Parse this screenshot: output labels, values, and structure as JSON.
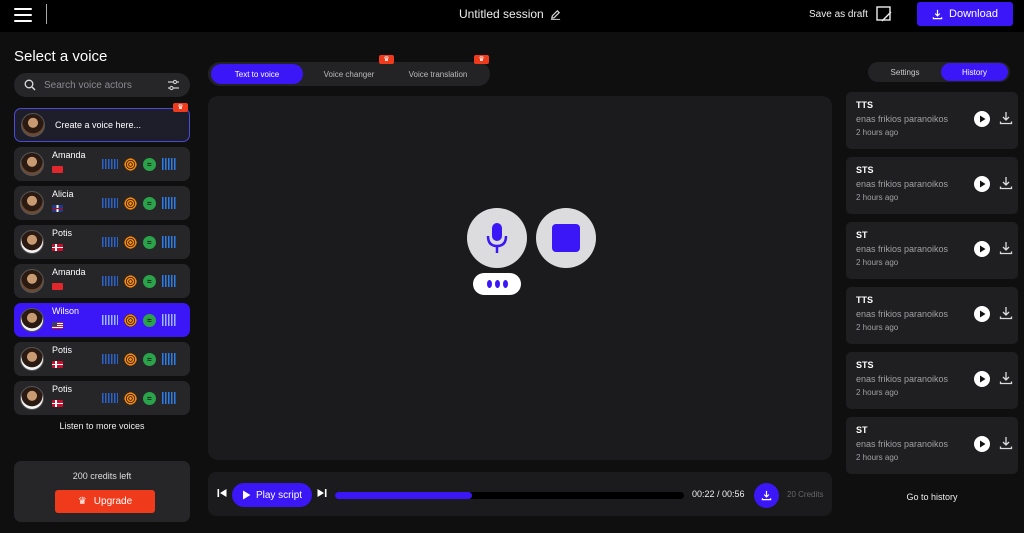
{
  "header": {
    "session_title": "Untitled session",
    "save_draft_label": "Save as draft",
    "download_label": "Download"
  },
  "left": {
    "title": "Select a voice",
    "search_placeholder": "Search voice actors",
    "create_label": "Create a voice here...",
    "voices": [
      {
        "name": "Amanda",
        "flag": "cn"
      },
      {
        "name": "Alicia",
        "flag": "uk"
      },
      {
        "name": "Potis",
        "flag": "dk"
      },
      {
        "name": "Amanda",
        "flag": "cn"
      },
      {
        "name": "Wilson",
        "flag": "us",
        "active": true
      },
      {
        "name": "Potis",
        "flag": "dk"
      },
      {
        "name": "Potis",
        "flag": "dk"
      }
    ],
    "more_label": "Listen to more voices",
    "credits_left": "200 credits left",
    "upgrade_label": "Upgrade"
  },
  "tabs": [
    {
      "label": "Text to voice",
      "active": true
    },
    {
      "label": "Voice changer",
      "premium": true
    },
    {
      "label": "Voice translation",
      "premium": true
    }
  ],
  "player": {
    "play_label": "Play script",
    "time": "00:22 / 00:56",
    "progress_fraction": 0.393,
    "credits": "20 Credits"
  },
  "right": {
    "tabs": [
      {
        "label": "Settings"
      },
      {
        "label": "History",
        "active": true
      }
    ],
    "history": [
      {
        "type": "TTS",
        "text": "enas frikios paranoikos",
        "time": "2 hours ago"
      },
      {
        "type": "STS",
        "text": "enas frikios paranoikos",
        "time": "2 hours ago"
      },
      {
        "type": "ST",
        "text": "enas frikios paranoikos",
        "time": "2 hours ago"
      },
      {
        "type": "TTS",
        "text": "enas frikios paranoikos",
        "time": "2 hours ago"
      },
      {
        "type": "STS",
        "text": "enas frikios paranoikos",
        "time": "2 hours ago"
      },
      {
        "type": "ST",
        "text": "enas frikios paranoikos",
        "time": "2 hours ago"
      }
    ],
    "goto_label": "Go to history"
  },
  "colors": {
    "accent": "#3b16f6",
    "premium": "#ef3b1b",
    "background": "#0f0f10",
    "panel": "#1b1b1d"
  },
  "icons": [
    "menu-icon",
    "edit-icon",
    "draft-icon",
    "download-icon",
    "search-icon",
    "filter-icon",
    "crown-icon",
    "mic-icon",
    "stop-icon",
    "skip-back-icon",
    "skip-forward-icon",
    "play-icon"
  ]
}
